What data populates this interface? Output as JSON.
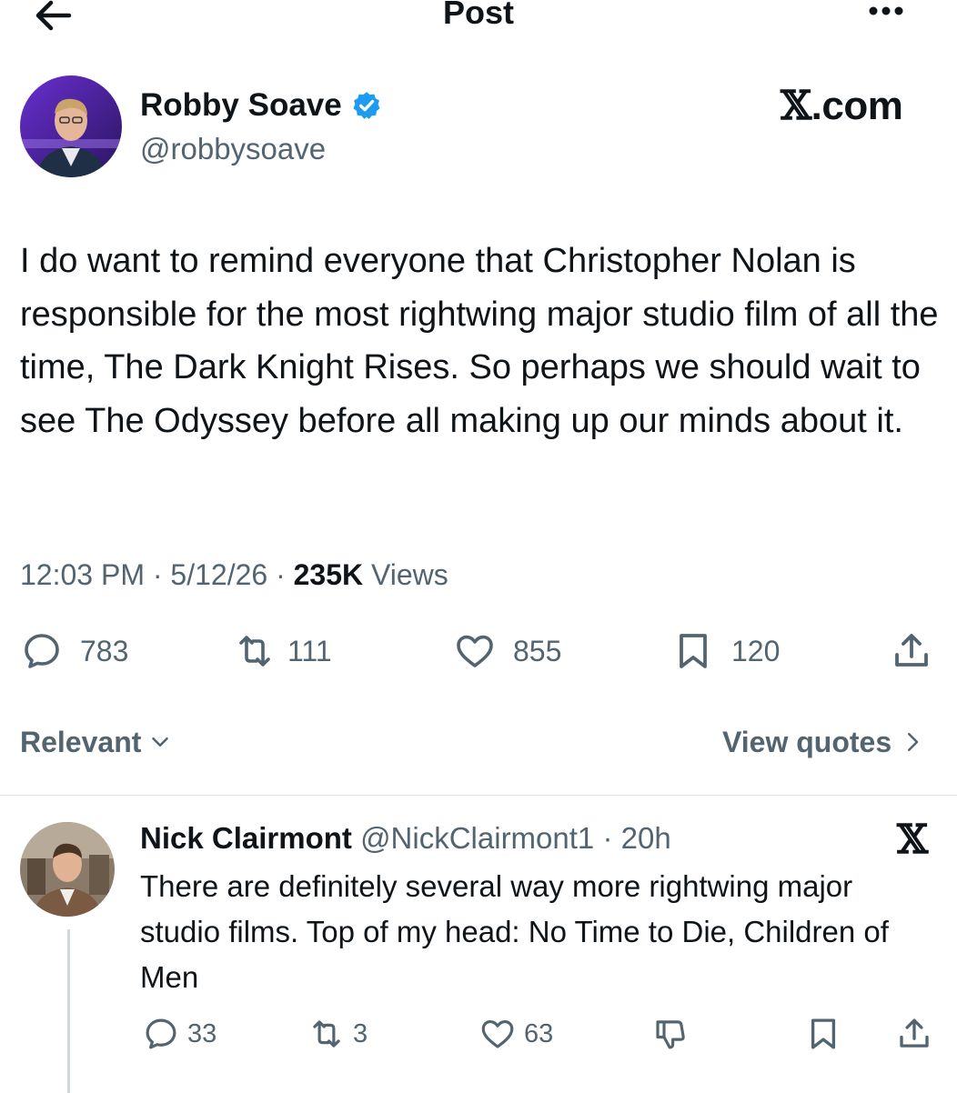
{
  "header": {
    "title": "Post",
    "back_icon": "arrow-left-icon",
    "more_icon": "more-horizontal-icon"
  },
  "post": {
    "author_name": "Robby Soave",
    "author_handle": "@robbysoave",
    "verified": true,
    "text": "I do want to remind everyone that Christopher Nolan is responsible for the most rightwing major studio film of all the time, The Dark Knight Rises. So perhaps we should wait to see The Odyssey before all making up our minds about it.",
    "time": "12:03 PM",
    "date": "5/12/26",
    "views_count": "235K",
    "views_label": "Views",
    "stats": {
      "replies": "783",
      "reposts": "111",
      "likes": "855",
      "bookmarks": "120"
    }
  },
  "watermark": {
    "x": "𝕏",
    "text": ".com"
  },
  "sort": {
    "label": "Relevant",
    "view_quotes": "View quotes"
  },
  "reply": {
    "name": "Nick Clairmont",
    "handle": "@NickClairmont1",
    "age": "20h",
    "text": "There are definitely several way more rightwing major studio films. Top of my head: No Time to Die, Children of Men",
    "stats": {
      "replies": "33",
      "reposts": "3",
      "likes": "63"
    },
    "x_badge": "𝕏"
  },
  "colors": {
    "text": "#0f1419",
    "secondary": "#536471",
    "verified": "#1d9bf0",
    "divider": "#dfe3e6"
  }
}
